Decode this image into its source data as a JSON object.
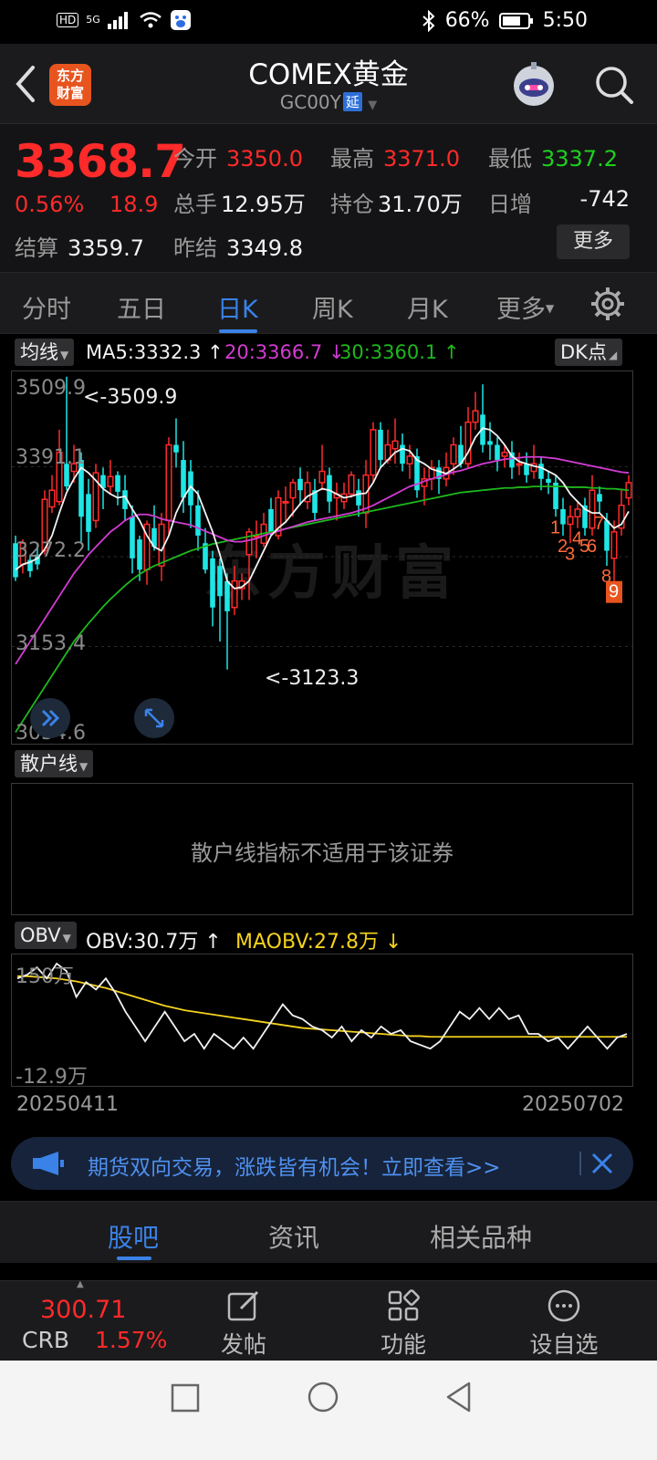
{
  "status_bar": {
    "chip_hd": "HD",
    "chip_5g": "5G",
    "battery": "66%",
    "time": "5:50"
  },
  "header": {
    "logo": "东方\n财富",
    "title": "COMEX黄金",
    "code": "GC00Y",
    "badge": "延"
  },
  "quote": {
    "price": "3368.7",
    "change_pct": "0.56%",
    "change": "18.9",
    "open_label": "今开",
    "open": "3350.0",
    "high_label": "最高",
    "high": "3371.0",
    "low_label": "最低",
    "low": "3337.2",
    "volume_label": "总手",
    "volume": "12.95万",
    "oi_label": "持仓",
    "oi": "31.70万",
    "oi_change_label": "日增",
    "oi_change": "-742",
    "settle_label": "结算",
    "settle": "3359.7",
    "prev_settle_label": "昨结",
    "prev_settle": "3349.8",
    "more": "更多"
  },
  "tabs": [
    "分时",
    "五日",
    "日K",
    "周K",
    "月K",
    "更多"
  ],
  "ma_legend": {
    "chip": "均线",
    "ma5": "MA5:3332.3 ↑",
    "ma20": "20:3366.7 ↓",
    "ma30": "30:3360.1 ↑",
    "dk_chip": "DK点",
    "colors": {
      "ma5": "#f2f2f2",
      "ma20": "#d23cd2",
      "ma30": "#1eb81e",
      "up": "#ff2a2a",
      "down": "#1ee6e6"
    }
  },
  "kline": {
    "yticks": [
      "3509.9",
      "3391.1",
      "3272.2",
      "3153.4",
      "3034.6"
    ],
    "high_annot": "<-3509.9",
    "low_annot": "<-3123.3",
    "watermark": "东方财富"
  },
  "chart_data": {
    "type": "candlestick",
    "ylim": [
      3034.6,
      3509.9
    ],
    "note_free": "",
    "candles": [
      [
        3290,
        3245,
        3300,
        3240
      ],
      [
        3262,
        3290,
        3295,
        3250
      ],
      [
        3268,
        3253,
        3275,
        3245
      ],
      [
        3275,
        3262,
        3290,
        3255
      ],
      [
        3280,
        3348,
        3360,
        3275
      ],
      [
        3338,
        3360,
        3380,
        3330
      ],
      [
        3345,
        3410,
        3440,
        3340
      ],
      [
        3395,
        3365,
        3510,
        3360
      ],
      [
        3385,
        3395,
        3420,
        3370
      ],
      [
        3400,
        3325,
        3410,
        3290
      ],
      [
        3355,
        3305,
        3375,
        3280
      ],
      [
        3320,
        3383,
        3395,
        3310
      ],
      [
        3380,
        3363,
        3390,
        3335
      ],
      [
        3365,
        3378,
        3400,
        3355
      ],
      [
        3380,
        3358,
        3385,
        3340
      ],
      [
        3360,
        3335,
        3380,
        3320
      ],
      [
        3325,
        3270,
        3340,
        3250
      ],
      [
        3295,
        3255,
        3300,
        3240
      ],
      [
        3255,
        3315,
        3320,
        3235
      ],
      [
        3310,
        3285,
        3340,
        3280
      ],
      [
        3260,
        3315,
        3330,
        3240
      ],
      [
        3320,
        3420,
        3430,
        3300
      ],
      [
        3420,
        3410,
        3455,
        3390
      ],
      [
        3400,
        3350,
        3425,
        3330
      ],
      [
        3385,
        3340,
        3400,
        3310
      ],
      [
        3340,
        3300,
        3360,
        3280
      ],
      [
        3290,
        3255,
        3310,
        3250
      ],
      [
        3270,
        3205,
        3280,
        3180
      ],
      [
        3260,
        3220,
        3270,
        3160
      ],
      [
        3240,
        3200,
        3250,
        3123
      ],
      [
        3205,
        3240,
        3260,
        3195
      ],
      [
        3230,
        3240,
        3250,
        3215
      ],
      [
        3275,
        3305,
        3310,
        3215
      ],
      [
        3300,
        3300,
        3320,
        3270
      ],
      [
        3290,
        3315,
        3330,
        3285
      ],
      [
        3335,
        3305,
        3350,
        3300
      ],
      [
        3300,
        3350,
        3360,
        3295
      ],
      [
        3345,
        3345,
        3365,
        3320
      ],
      [
        3350,
        3370,
        3375,
        3325
      ],
      [
        3375,
        3360,
        3390,
        3340
      ],
      [
        3345,
        3370,
        3385,
        3335
      ],
      [
        3360,
        3330,
        3375,
        3320
      ],
      [
        3370,
        3385,
        3420,
        3360
      ],
      [
        3380,
        3345,
        3390,
        3330
      ],
      [
        3350,
        3355,
        3370,
        3320
      ],
      [
        3345,
        3355,
        3370,
        3335
      ],
      [
        3355,
        3380,
        3385,
        3350
      ],
      [
        3360,
        3340,
        3375,
        3325
      ],
      [
        3330,
        3380,
        3400,
        3310
      ],
      [
        3380,
        3440,
        3450,
        3370
      ],
      [
        3440,
        3400,
        3450,
        3390
      ],
      [
        3400,
        3420,
        3440,
        3395
      ],
      [
        3415,
        3425,
        3455,
        3395
      ],
      [
        3420,
        3395,
        3435,
        3385
      ],
      [
        3395,
        3405,
        3420,
        3375
      ],
      [
        3405,
        3360,
        3415,
        3350
      ],
      [
        3365,
        3375,
        3390,
        3340
      ],
      [
        3375,
        3390,
        3400,
        3360
      ],
      [
        3390,
        3375,
        3400,
        3355
      ],
      [
        3375,
        3390,
        3410,
        3365
      ],
      [
        3395,
        3420,
        3430,
        3380
      ],
      [
        3420,
        3395,
        3445,
        3390
      ],
      [
        3395,
        3450,
        3470,
        3390
      ],
      [
        3450,
        3465,
        3490,
        3440
      ],
      [
        3460,
        3420,
        3500,
        3410
      ],
      [
        3425,
        3420,
        3450,
        3400
      ],
      [
        3420,
        3400,
        3430,
        3385
      ],
      [
        3405,
        3410,
        3420,
        3390
      ],
      [
        3410,
        3390,
        3425,
        3375
      ],
      [
        3395,
        3395,
        3410,
        3380
      ],
      [
        3395,
        3380,
        3410,
        3370
      ],
      [
        3385,
        3395,
        3420,
        3375
      ],
      [
        3395,
        3375,
        3405,
        3360
      ],
      [
        3375,
        3370,
        3385,
        3355
      ],
      [
        3370,
        3335,
        3380,
        3325
      ],
      [
        3335,
        3315,
        3350,
        3300
      ],
      [
        3315,
        3325,
        3340,
        3290
      ],
      [
        3325,
        3335,
        3345,
        3310
      ],
      [
        3340,
        3310,
        3350,
        3300
      ],
      [
        3310,
        3360,
        3380,
        3300
      ],
      [
        3355,
        3345,
        3365,
        3330
      ],
      [
        3320,
        3280,
        3330,
        3260
      ],
      [
        3270,
        3305,
        3320,
        3240
      ],
      [
        3310,
        3340,
        3360,
        3300
      ],
      [
        3350,
        3370,
        3380,
        3340
      ]
    ],
    "ma5": [
      3255,
      3262,
      3265,
      3270,
      3282,
      3300,
      3330,
      3357,
      3375,
      3390,
      3383,
      3373,
      3362,
      3355,
      3350,
      3352,
      3335,
      3320,
      3300,
      3285,
      3280,
      3300,
      3330,
      3350,
      3365,
      3355,
      3330,
      3305,
      3275,
      3240,
      3230,
      3232,
      3240,
      3260,
      3280,
      3300,
      3310,
      3318,
      3330,
      3342,
      3352,
      3357,
      3362,
      3360,
      3355,
      3350,
      3352,
      3355,
      3356,
      3370,
      3390,
      3400,
      3410,
      3415,
      3412,
      3400,
      3395,
      3388,
      3385,
      3382,
      3388,
      3395,
      3410,
      3430,
      3442,
      3440,
      3432,
      3420,
      3405,
      3398,
      3395,
      3392,
      3390,
      3385,
      3380,
      3370,
      3355,
      3345,
      3335,
      3330,
      3330,
      3320,
      3310,
      3315,
      3332
    ],
    "ma20": [
      3130,
      3145,
      3160,
      3175,
      3190,
      3205,
      3220,
      3235,
      3250,
      3262,
      3275,
      3285,
      3295,
      3305,
      3312,
      3320,
      3325,
      3328,
      3328,
      3326,
      3322,
      3320,
      3318,
      3316,
      3314,
      3310,
      3306,
      3302,
      3298,
      3294,
      3292,
      3292,
      3294,
      3296,
      3300,
      3303,
      3306,
      3309,
      3312,
      3315,
      3318,
      3320,
      3322,
      3324,
      3326,
      3328,
      3330,
      3333,
      3336,
      3340,
      3345,
      3350,
      3355,
      3360,
      3365,
      3368,
      3372,
      3375,
      3378,
      3381,
      3384,
      3386,
      3389,
      3392,
      3395,
      3397,
      3399,
      3401,
      3402,
      3403,
      3404,
      3404,
      3404,
      3403,
      3402,
      3400,
      3398,
      3396,
      3394,
      3392,
      3390,
      3388,
      3386,
      3384,
      3383
    ],
    "ma30": [
      3040,
      3055,
      3070,
      3085,
      3100,
      3115,
      3130,
      3145,
      3160,
      3172,
      3184,
      3195,
      3206,
      3216,
      3225,
      3234,
      3242,
      3249,
      3255,
      3260,
      3264,
      3268,
      3272,
      3276,
      3280,
      3283,
      3286,
      3289,
      3291,
      3293,
      3295,
      3297,
      3299,
      3301,
      3303,
      3305,
      3307,
      3309,
      3311,
      3313,
      3315,
      3317,
      3319,
      3321,
      3323,
      3325,
      3327,
      3329,
      3331,
      3333,
      3335,
      3337,
      3339,
      3341,
      3343,
      3345,
      3347,
      3349,
      3351,
      3353,
      3355,
      3357,
      3358,
      3359,
      3360,
      3361,
      3362,
      3363,
      3363,
      3364,
      3364,
      3365,
      3365,
      3365,
      3365,
      3365,
      3364,
      3364,
      3364,
      3363,
      3363,
      3362,
      3362,
      3361,
      3360
    ],
    "dk_marks": [
      {
        "label": "1",
        "index": 74
      },
      {
        "label": "2",
        "index": 75
      },
      {
        "label": "3",
        "index": 76
      },
      {
        "label": "4",
        "index": 77
      },
      {
        "label": "5",
        "index": 78
      },
      {
        "label": "6",
        "index": 79
      },
      {
        "label": "7",
        "index": 80
      },
      {
        "label": "8",
        "index": 81
      },
      {
        "label": "9",
        "index": 82
      }
    ],
    "obv": {
      "ylim": [
        -12.9,
        150
      ],
      "yticks": [
        "150万",
        "-12.9万"
      ],
      "obv": [
        125,
        130,
        140,
        125,
        145,
        135,
        100,
        120,
        110,
        125,
        105,
        80,
        60,
        40,
        60,
        80,
        60,
        40,
        50,
        30,
        50,
        40,
        30,
        45,
        30,
        50,
        70,
        90,
        75,
        70,
        60,
        55,
        45,
        60,
        40,
        55,
        45,
        60,
        50,
        55,
        40,
        35,
        30,
        40,
        60,
        80,
        70,
        85,
        70,
        85,
        70,
        75,
        50,
        50,
        40,
        45,
        30,
        45,
        60,
        45,
        30,
        45,
        50
      ],
      "maobv": [
        128,
        128,
        127,
        126,
        125,
        123,
        121,
        118,
        115,
        112,
        108,
        104,
        100,
        96,
        92,
        88,
        85,
        82,
        80,
        78,
        76,
        74,
        72,
        70,
        68,
        66,
        64,
        62,
        60,
        58,
        57,
        56,
        55,
        54,
        53,
        52,
        51,
        50,
        49,
        48,
        47,
        47,
        46,
        46,
        46,
        46,
        46,
        46,
        46,
        46,
        46,
        46,
        46,
        46,
        46,
        46,
        46,
        46,
        46,
        46,
        46,
        46,
        46
      ]
    },
    "dates": [
      "20250411",
      "20250702"
    ]
  },
  "retail": {
    "chip": "散户线",
    "message": "散户线指标不适用于该证券"
  },
  "obv_legend": {
    "chip": "OBV",
    "obv": "OBV:30.7万 ↑",
    "maobv": "MAOBV:27.8万 ↓"
  },
  "banner": {
    "text": "期货双向交易，涨跌皆有机会！立即查看>>"
  },
  "bottom_tabs": [
    "股吧",
    "资讯",
    "相关品种"
  ],
  "footer": {
    "crb_value": "300.71",
    "crb_label": "CRB",
    "crb_change": "1.57%",
    "post": "发帖",
    "functions": "功能",
    "watchlist": "设自选"
  }
}
